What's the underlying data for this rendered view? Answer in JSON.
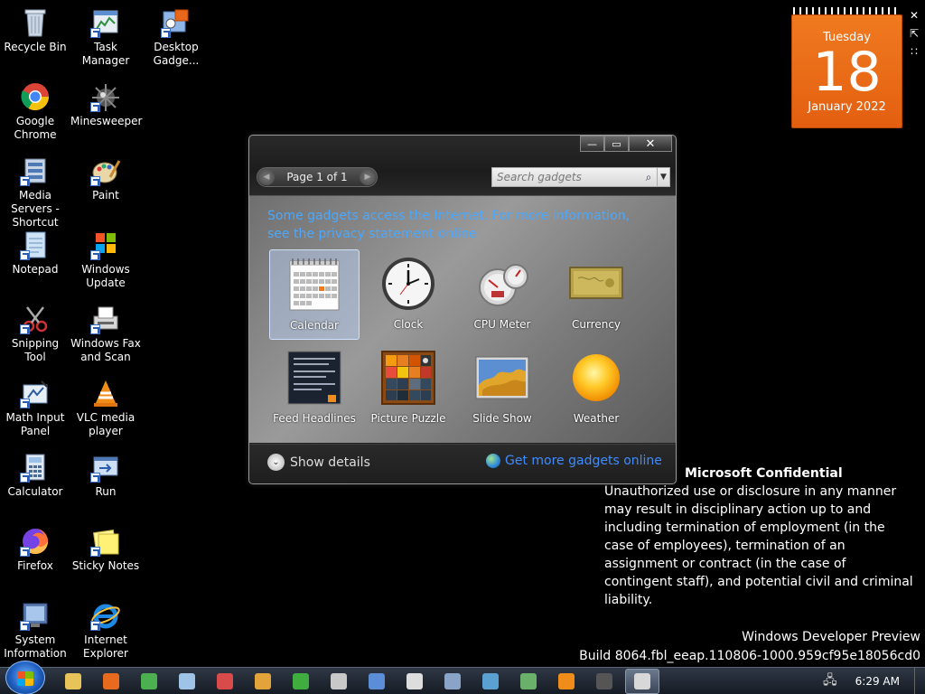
{
  "desktop_icons": [
    {
      "label": "Recycle Bin",
      "icon": "recycle-bin-icon"
    },
    {
      "label": "Task Manager",
      "icon": "task-manager-icon"
    },
    {
      "label": "Desktop Gadge...",
      "icon": "desktop-gadgets-icon"
    },
    {
      "label": "Google Chrome",
      "icon": "chrome-icon"
    },
    {
      "label": "Minesweeper",
      "icon": "minesweeper-icon"
    },
    {
      "label": "Media Servers - Shortcut",
      "icon": "media-servers-icon"
    },
    {
      "label": "Paint",
      "icon": "paint-icon"
    },
    {
      "label": "Notepad",
      "icon": "notepad-icon"
    },
    {
      "label": "Windows Update",
      "icon": "windows-update-icon"
    },
    {
      "label": "Snipping Tool",
      "icon": "snipping-tool-icon"
    },
    {
      "label": "Windows Fax and Scan",
      "icon": "fax-scan-icon"
    },
    {
      "label": "Math Input Panel",
      "icon": "math-input-icon"
    },
    {
      "label": "VLC media player",
      "icon": "vlc-icon"
    },
    {
      "label": "Calculator",
      "icon": "calculator-icon"
    },
    {
      "label": "Run",
      "icon": "run-icon"
    },
    {
      "label": "Firefox",
      "icon": "firefox-icon"
    },
    {
      "label": "Sticky Notes",
      "icon": "sticky-notes-icon"
    },
    {
      "label": "System Information",
      "icon": "system-info-icon"
    },
    {
      "label": "Internet Explorer",
      "icon": "internet-explorer-icon"
    }
  ],
  "gallery": {
    "minimize": "—",
    "maximize": "▭",
    "close": "✕",
    "pager_text": "Page 1 of 1",
    "prev": "◀",
    "next": "▶",
    "search_placeholder": "Search gadgets",
    "search_icon": "⌕",
    "search_dropdown": "▼",
    "notice": "Some gadgets access the Internet.  For more information, see the privacy statement online",
    "gadgets": [
      {
        "label": "Calendar",
        "icon": "calendar-gadget-icon",
        "selected": true
      },
      {
        "label": "Clock",
        "icon": "clock-gadget-icon",
        "selected": false
      },
      {
        "label": "CPU Meter",
        "icon": "cpu-meter-gadget-icon",
        "selected": false
      },
      {
        "label": "Currency",
        "icon": "currency-gadget-icon",
        "selected": false
      },
      {
        "label": "Feed Headlines",
        "icon": "feed-headlines-gadget-icon",
        "selected": false
      },
      {
        "label": "Picture Puzzle",
        "icon": "picture-puzzle-gadget-icon",
        "selected": false
      },
      {
        "label": "Slide Show",
        "icon": "slide-show-gadget-icon",
        "selected": false
      },
      {
        "label": "Weather",
        "icon": "weather-gadget-icon",
        "selected": false
      }
    ],
    "show_details": "Show details",
    "chevron": "⌄",
    "online_link": "Get more gadgets online"
  },
  "calendar_gadget": {
    "weekday": "Tuesday",
    "day": "18",
    "month_year": "January 2022",
    "accent": "#e8671a"
  },
  "sidebar_buttons": [
    "✕",
    "⇱",
    "∷"
  ],
  "confidential": {
    "heading": "Microsoft Confidential",
    "body": "Unauthorized use or disclosure in any manner may result in disciplinary action up to and including termination of employment (in the case of employees), termination of an assignment or contract (in the case of contingent staff), and potential civil and criminal liability."
  },
  "build": {
    "line1": "Windows Developer Preview",
    "line2": "Build 8064.fbl_eeap.110806-1000.959cf95e18056cd0"
  },
  "taskbar": {
    "items": [
      {
        "icon": "explorer-icon",
        "color": "#e8c35a"
      },
      {
        "icon": "firefox-icon",
        "color": "#e86a1f"
      },
      {
        "icon": "chrome-icon",
        "color": "#4caf50"
      },
      {
        "icon": "notepad-icon",
        "color": "#9fc3e6"
      },
      {
        "icon": "snipping-tool-icon",
        "color": "#d94a4a"
      },
      {
        "icon": "paint-icon",
        "color": "#e3a33b"
      },
      {
        "icon": "windows-update-icon",
        "color": "#3fae3f"
      },
      {
        "icon": "fax-scan-icon",
        "color": "#c8c8c8"
      },
      {
        "icon": "math-input-icon",
        "color": "#5b8ed6"
      },
      {
        "icon": "clock-icon",
        "color": "#dddddd"
      },
      {
        "icon": "system-info-icon",
        "color": "#8aa4c8"
      },
      {
        "icon": "network-icon",
        "color": "#5aa0d0"
      },
      {
        "icon": "media-icon",
        "color": "#6ab06a"
      },
      {
        "icon": "vlc-icon",
        "color": "#f08c1a"
      },
      {
        "icon": "cmd-icon",
        "color": "#555555"
      },
      {
        "icon": "gadgets-icon",
        "color": "#d8d8d8",
        "active": true
      }
    ],
    "clock": "6:29 AM"
  }
}
